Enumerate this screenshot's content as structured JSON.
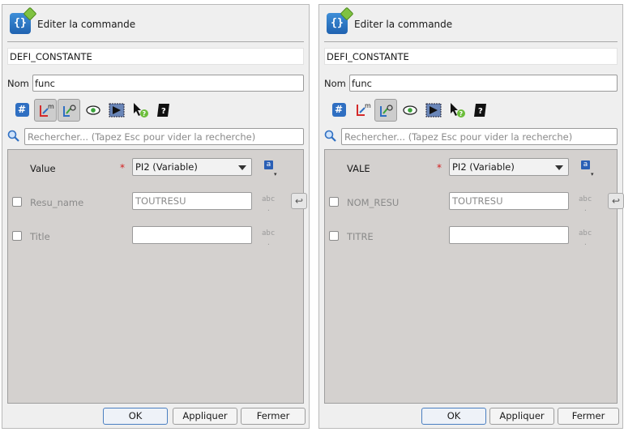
{
  "left": {
    "title": "Editer la commande",
    "command": "DEFI_CONSTANTE",
    "nom_label": "Nom",
    "nom_value": "func",
    "search_placeholder": "Rechercher... (Tapez Esc pour vider la recherche)",
    "rows": [
      {
        "label": "Value",
        "required": "*",
        "value": "PI2 (Variable)",
        "type_icon": "a"
      },
      {
        "label": "Resu_name",
        "value": "TOUTRESU",
        "type_icon": "abc"
      },
      {
        "label": "Title",
        "value": "",
        "type_icon": "abc"
      }
    ],
    "buttons": {
      "ok": "OK",
      "apply": "Appliquer",
      "close": "Fermer"
    }
  },
  "right": {
    "title": "Editer la commande",
    "command": "DEFI_CONSTANTE",
    "nom_label": "Nom",
    "nom_value": "func",
    "search_placeholder": "Rechercher... (Tapez Esc pour vider la recherche)",
    "rows": [
      {
        "label": "VALE",
        "required": "*",
        "value": "PI2 (Variable)",
        "type_icon": "a"
      },
      {
        "label": "NOM_RESU",
        "value": "TOUTRESU",
        "type_icon": "abc"
      },
      {
        "label": "TITRE",
        "value": "",
        "type_icon": "abc"
      }
    ],
    "buttons": {
      "ok": "OK",
      "apply": "Appliquer",
      "close": "Fermer"
    }
  },
  "colors": {
    "accent": "#2f6fc2",
    "content_bg": "#d4d1cf",
    "required": "#d32020"
  }
}
